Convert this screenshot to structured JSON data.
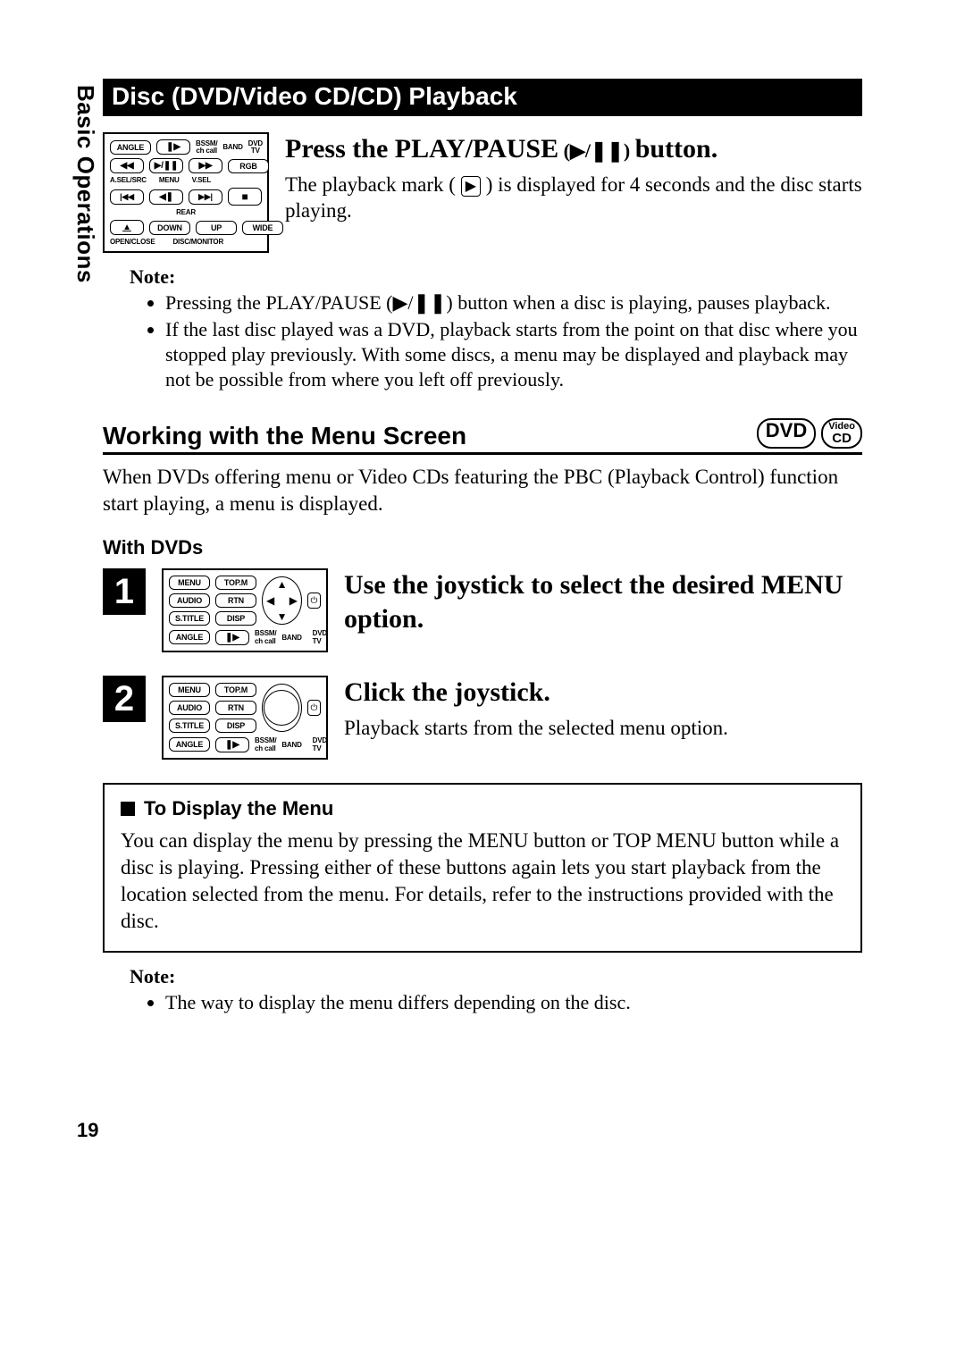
{
  "sidebar_heading": "Basic Operations",
  "page_number": "19",
  "section_title": "Disc (DVD/Video CD/CD) Playback",
  "remote_top": {
    "row1": {
      "angle": "ANGLE",
      "step": "",
      "bssm": "BSSM/\nch call",
      "band": "BAND",
      "dvd_tv": "DVD\nTV"
    },
    "row2": {
      "rw": "",
      "pp": "",
      "ff": "",
      "rgb": "RGB",
      "asel": "A.SEL/SRC",
      "menu": "MENU",
      "vsel": "V.SEL"
    },
    "row3": {
      "prev": "",
      "stepb": "",
      "next": "",
      "stop": "",
      "rear": "REAR"
    },
    "row4": {
      "eject": "",
      "down": "DOWN",
      "up": "UP",
      "wide": "WIDE",
      "open": "OPEN/CLOSE",
      "disc": "DISC/MONITOR"
    }
  },
  "step_play": {
    "title_a": "Press the PLAY/PAUSE",
    "title_b": "button.",
    "body_a": "The playback mark (",
    "body_b": ") is displayed for 4 seconds and the disc starts playing.",
    "mark_glyph": "▶"
  },
  "note1": {
    "label": "Note:",
    "items": [
      "Pressing the PLAY/PAUSE (▶/❚❚) button when a disc is playing, pauses playback.",
      "If the last disc played was a DVD, playback starts from the point on that disc where you stopped play previously. With some discs, a menu may be displayed and playback may not be possible from where you left off previously."
    ]
  },
  "subsection": {
    "title": "Working with the Menu Screen",
    "badges": {
      "dvd": "DVD",
      "vcd_top": "Video",
      "vcd_bottom": "CD"
    },
    "intro": "When DVDs offering menu or Video CDs featuring the PBC (Playback Control) function start playing, a menu is displayed."
  },
  "with_dvds_heading": "With DVDs",
  "remote_btns": {
    "menu": "MENU",
    "topm": "TOP.M",
    "audio": "AUDIO",
    "rtn": "RTN",
    "stitle": "S.TITLE",
    "disp": "DISP",
    "angle": "ANGLE"
  },
  "step1": {
    "num": "1",
    "title": "Use the joystick to select the desired MENU option."
  },
  "step2": {
    "num": "2",
    "title": "Click the joystick.",
    "body": "Playback starts from the selected menu option."
  },
  "box": {
    "title": "To Display the Menu",
    "body": "You can display the menu by pressing the MENU button or TOP MENU button while a disc is playing. Pressing either of these buttons again lets you start playback from the location selected from the menu. For details, refer to the instructions provided with the disc."
  },
  "note2": {
    "label": "Note:",
    "items": [
      "The way to display the menu differs depending on the disc."
    ]
  }
}
